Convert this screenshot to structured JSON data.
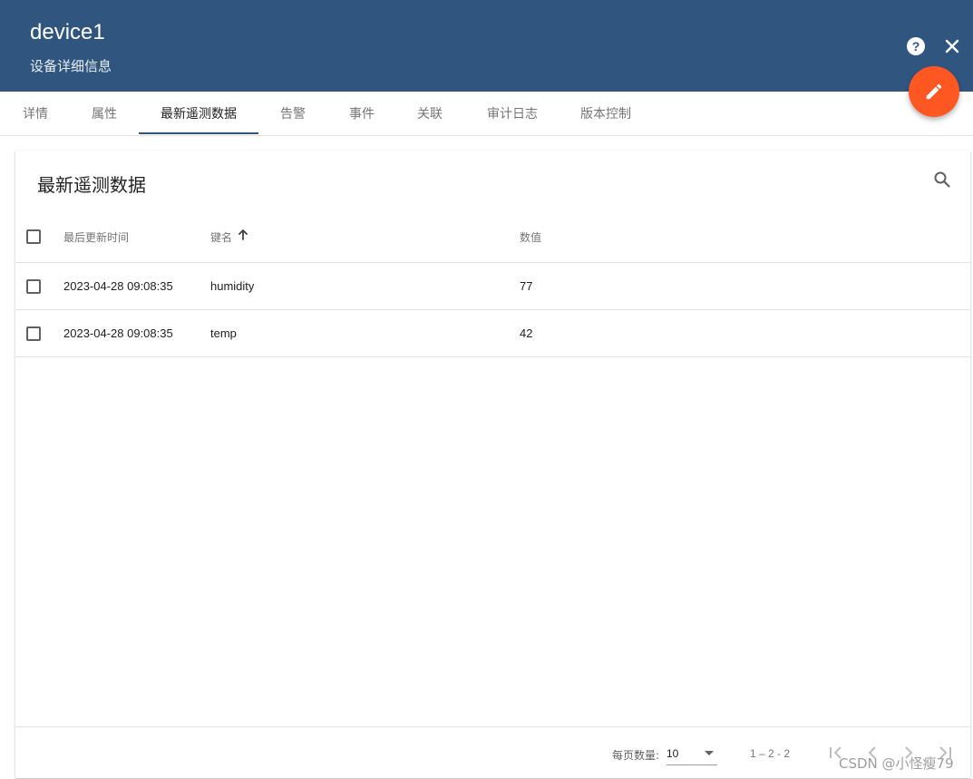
{
  "header": {
    "title": "device1",
    "subtitle": "设备详细信息",
    "bg_color": "#305680"
  },
  "fab": {
    "icon": "edit-icon",
    "color": "#ff5722"
  },
  "tabs": [
    {
      "label": "详情",
      "active": false
    },
    {
      "label": "属性",
      "active": false
    },
    {
      "label": "最新遥测数据",
      "active": true
    },
    {
      "label": "告警",
      "active": false
    },
    {
      "label": "事件",
      "active": false
    },
    {
      "label": "关联",
      "active": false
    },
    {
      "label": "审计日志",
      "active": false
    },
    {
      "label": "版本控制",
      "active": false
    }
  ],
  "panel": {
    "title": "最新遥测数据",
    "columns": {
      "last_update": "最后更新时间",
      "key": "键名",
      "value": "数值"
    },
    "sort": {
      "column": "key",
      "direction": "ascending",
      "icon": "arrow-up-icon"
    },
    "rows": [
      {
        "last_update": "2023-04-28 09:08:35",
        "key": "humidity",
        "value": "77"
      },
      {
        "last_update": "2023-04-28 09:08:35",
        "key": "temp",
        "value": "42"
      }
    ]
  },
  "pagination": {
    "page_size_label": "每页数量:",
    "page_size": "10",
    "range": "1 – 2 - 2"
  },
  "watermark": "CSDN @小怪瘦79"
}
